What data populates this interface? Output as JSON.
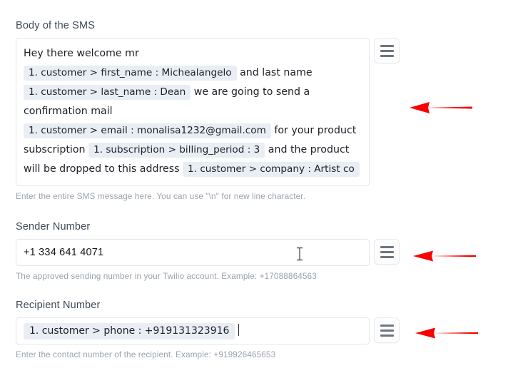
{
  "form": {
    "fields": [
      {
        "id": "body-of-sms",
        "label": "Body of the SMS",
        "helper": "Enter the entire SMS message here. You can use \"\\n\" for new line character.",
        "menu_icon": "hamburger-menu-icon",
        "content_parts": [
          {
            "type": "text",
            "value": "Hey there welcome mr"
          },
          {
            "type": "break"
          },
          {
            "type": "token",
            "value": "1. customer > first_name : Michealangelo"
          },
          {
            "type": "text",
            "value": " and last name "
          },
          {
            "type": "token",
            "value": "1. customer > last_name : Dean"
          },
          {
            "type": "text",
            "value": " we are going to send a confirmation mail "
          },
          {
            "type": "token",
            "value": "1. customer > email : monalisa1232@gmail.com"
          },
          {
            "type": "text",
            "value": " for your product subscription "
          },
          {
            "type": "token",
            "value": "1. subscription > billing_period : 3"
          },
          {
            "type": "text",
            "value": " and the product will be dropped to this address "
          },
          {
            "type": "token",
            "value": "1. customer > company : Artist co"
          }
        ]
      },
      {
        "id": "sender-number",
        "label": "Sender Number",
        "value": "+1 334 641 4071",
        "helper": "The approved sending number in your Twilio account. Example: +17088864563",
        "menu_icon": "hamburger-menu-icon"
      },
      {
        "id": "recipient-number",
        "label": "Recipient Number",
        "token_value": "1. customer > phone : +919131323916",
        "helper": "Enter the contact number of the recipient. Example: +919926465653",
        "menu_icon": "hamburger-menu-icon"
      }
    ]
  },
  "annotations": {
    "color": "#fb0000",
    "arrows": [
      {
        "name": "arrow-body-of-sms"
      },
      {
        "name": "arrow-sender-number"
      },
      {
        "name": "arrow-recipient-number"
      }
    ]
  },
  "cursor": {
    "type": "text-ibeam-cursor"
  },
  "colors": {
    "token_background": "#e9eef5",
    "label_text": "#3f4a56",
    "helper_text": "#9ba3ae",
    "border": "#e3e6eb",
    "annotation_red": "#fb0000"
  }
}
